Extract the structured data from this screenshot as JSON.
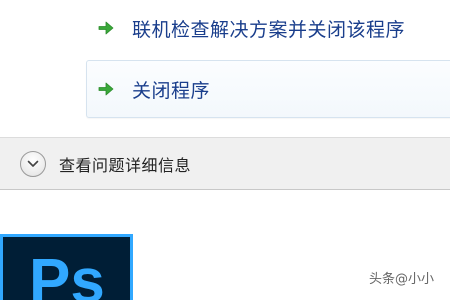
{
  "dialog": {
    "options": [
      {
        "label": "联机检查解决方案并关闭该程序",
        "icon": "green-arrow-icon"
      },
      {
        "label": "关闭程序",
        "icon": "green-arrow-icon"
      }
    ],
    "footer": {
      "expand_icon": "chevron-down-icon",
      "label": "查看问题详细信息"
    }
  },
  "app_icon": {
    "text": "Ps",
    "colors": {
      "background": "#001e36",
      "accent": "#31a8ff"
    }
  },
  "watermark": "头条@小小"
}
